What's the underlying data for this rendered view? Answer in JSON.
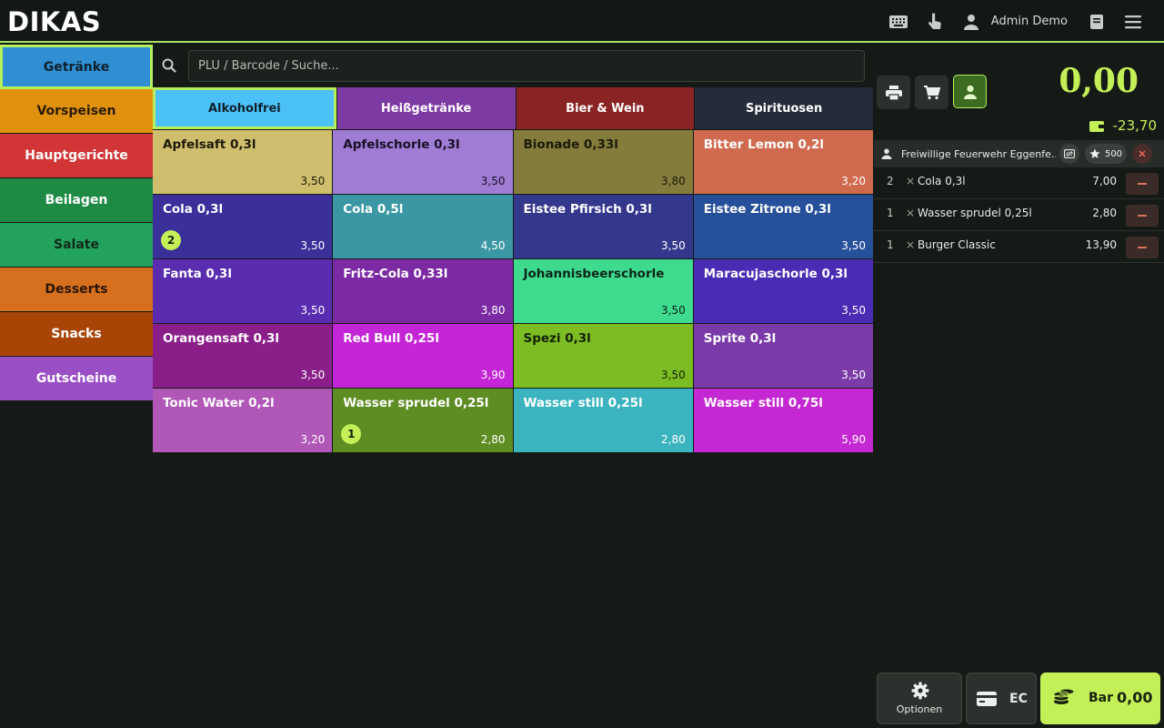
{
  "header": {
    "logo_text": "DIKAS",
    "user_name": "Admin Demo",
    "icons": [
      "keyboard-icon",
      "touch-icon",
      "user-icon",
      "book-icon",
      "menu-icon"
    ],
    "accent_color": "#a8e063"
  },
  "categories": [
    {
      "label": "Getränke",
      "color": "#2f8fd2",
      "text_color": "#10202c",
      "active": true
    },
    {
      "label": "Vorspeisen",
      "color": "#e0920f",
      "text_color": "#2a1a04"
    },
    {
      "label": "Hauptgerichte",
      "color": "#d13535",
      "text_color": "#ffffff"
    },
    {
      "label": "Beilagen",
      "color": "#1f8a45",
      "text_color": "#ffffff"
    },
    {
      "label": "Salate",
      "color": "#22a25c",
      "text_color": "#102a1a"
    },
    {
      "label": "Desserts",
      "color": "#d7701e",
      "text_color": "#2a1504"
    },
    {
      "label": "Snacks",
      "color": "#a84406",
      "text_color": "#ffffff"
    },
    {
      "label": "Gutscheine",
      "color": "#9b4fc6",
      "text_color": "#ffffff"
    }
  ],
  "search": {
    "placeholder": "PLU / Barcode / Suche..."
  },
  "subcategories": [
    {
      "label": "Alkoholfrei",
      "color": "#4cc1f7",
      "text_color": "#10202c",
      "active": true
    },
    {
      "label": "Heißgetränke",
      "color": "#7d3aa3",
      "text_color": "#ffffff"
    },
    {
      "label": "Bier & Wein",
      "color": "#8a2424",
      "text_color": "#ffffff"
    },
    {
      "label": "Spirituosen",
      "color": "#242c3a",
      "text_color": "#ffffff"
    }
  ],
  "products": [
    {
      "name": "Apfelsaft 0,3l",
      "price": "3,50",
      "color": "#cfbe6d",
      "text_color": "#1e1a08"
    },
    {
      "name": "Apfelschorle 0,3l",
      "price": "3,50",
      "color": "#a07cd4",
      "text_color": "#1a1026"
    },
    {
      "name": "Bionade 0,33l",
      "price": "3,80",
      "color": "#847c3c",
      "text_color": "#1c1a0a"
    },
    {
      "name": "Bitter Lemon 0,2l",
      "price": "3,20",
      "color": "#d06a4f",
      "text_color": "#ffffff"
    },
    {
      "name": "Cola 0,3l",
      "price": "3,50",
      "color": "#3b2f9a",
      "text_color": "#ffffff",
      "badge": "2"
    },
    {
      "name": "Cola 0,5l",
      "price": "4,50",
      "color": "#3c97a4",
      "text_color": "#ffffff"
    },
    {
      "name": "Eistee Pfirsich 0,3l",
      "price": "3,50",
      "color": "#34388c",
      "text_color": "#ffffff"
    },
    {
      "name": "Eistee Zitrone 0,3l",
      "price": "3,50",
      "color": "#27509a",
      "text_color": "#ffffff"
    },
    {
      "name": "Fanta 0,3l",
      "price": "3,50",
      "color": "#5a2db0",
      "text_color": "#ffffff"
    },
    {
      "name": "Fritz-Cola 0,33l",
      "price": "3,80",
      "color": "#7b2aa4",
      "text_color": "#ffffff"
    },
    {
      "name": "Johannisbeerschorle",
      "price": "3,50",
      "color": "#3edb8f",
      "text_color": "#0e2418"
    },
    {
      "name": "Maracujaschorle 0,3l",
      "price": "3,50",
      "color": "#4a2bb3",
      "text_color": "#ffffff"
    },
    {
      "name": "Orangensaft 0,3l",
      "price": "3,50",
      "color": "#8a1f8a",
      "text_color": "#ffffff"
    },
    {
      "name": "Red Bull 0,25l",
      "price": "3,90",
      "color": "#c425d6",
      "text_color": "#ffffff"
    },
    {
      "name": "Spezi 0,3l",
      "price": "3,50",
      "color": "#7bbd22",
      "text_color": "#132006"
    },
    {
      "name": "Sprite 0,3l",
      "price": "3,50",
      "color": "#7a3ba8",
      "text_color": "#ffffff"
    },
    {
      "name": "Tonic Water 0,2l",
      "price": "3,20",
      "color": "#b057b8",
      "text_color": "#ffffff"
    },
    {
      "name": "Wasser sprudel 0,25l",
      "price": "2,80",
      "color": "#5e8d23",
      "text_color": "#ffffff",
      "badge": "1"
    },
    {
      "name": "Wasser still 0,25l",
      "price": "2,80",
      "color": "#3cb4bf",
      "text_color": "#ffffff"
    },
    {
      "name": "Wasser still 0,75l",
      "price": "5,90",
      "color": "#c328d2",
      "text_color": "#ffffff"
    }
  ],
  "order": {
    "total": "0,00",
    "balance": "-23,70",
    "customer": {
      "name": "Freiwillige Feuerwehr Eggenfe...",
      "points": "500"
    },
    "items": [
      {
        "qty": "2",
        "times": "×",
        "name": "Cola 0,3l",
        "price": "7,00"
      },
      {
        "qty": "1",
        "times": "×",
        "name": "Wasser sprudel 0,25l",
        "price": "2,80"
      },
      {
        "qty": "1",
        "times": "×",
        "name": "Burger Classic",
        "price": "13,90"
      }
    ]
  },
  "footer": {
    "options_label": "Optionen",
    "ec_label": "EC",
    "bar_label": "Bar",
    "bar_amount": "0,00"
  }
}
